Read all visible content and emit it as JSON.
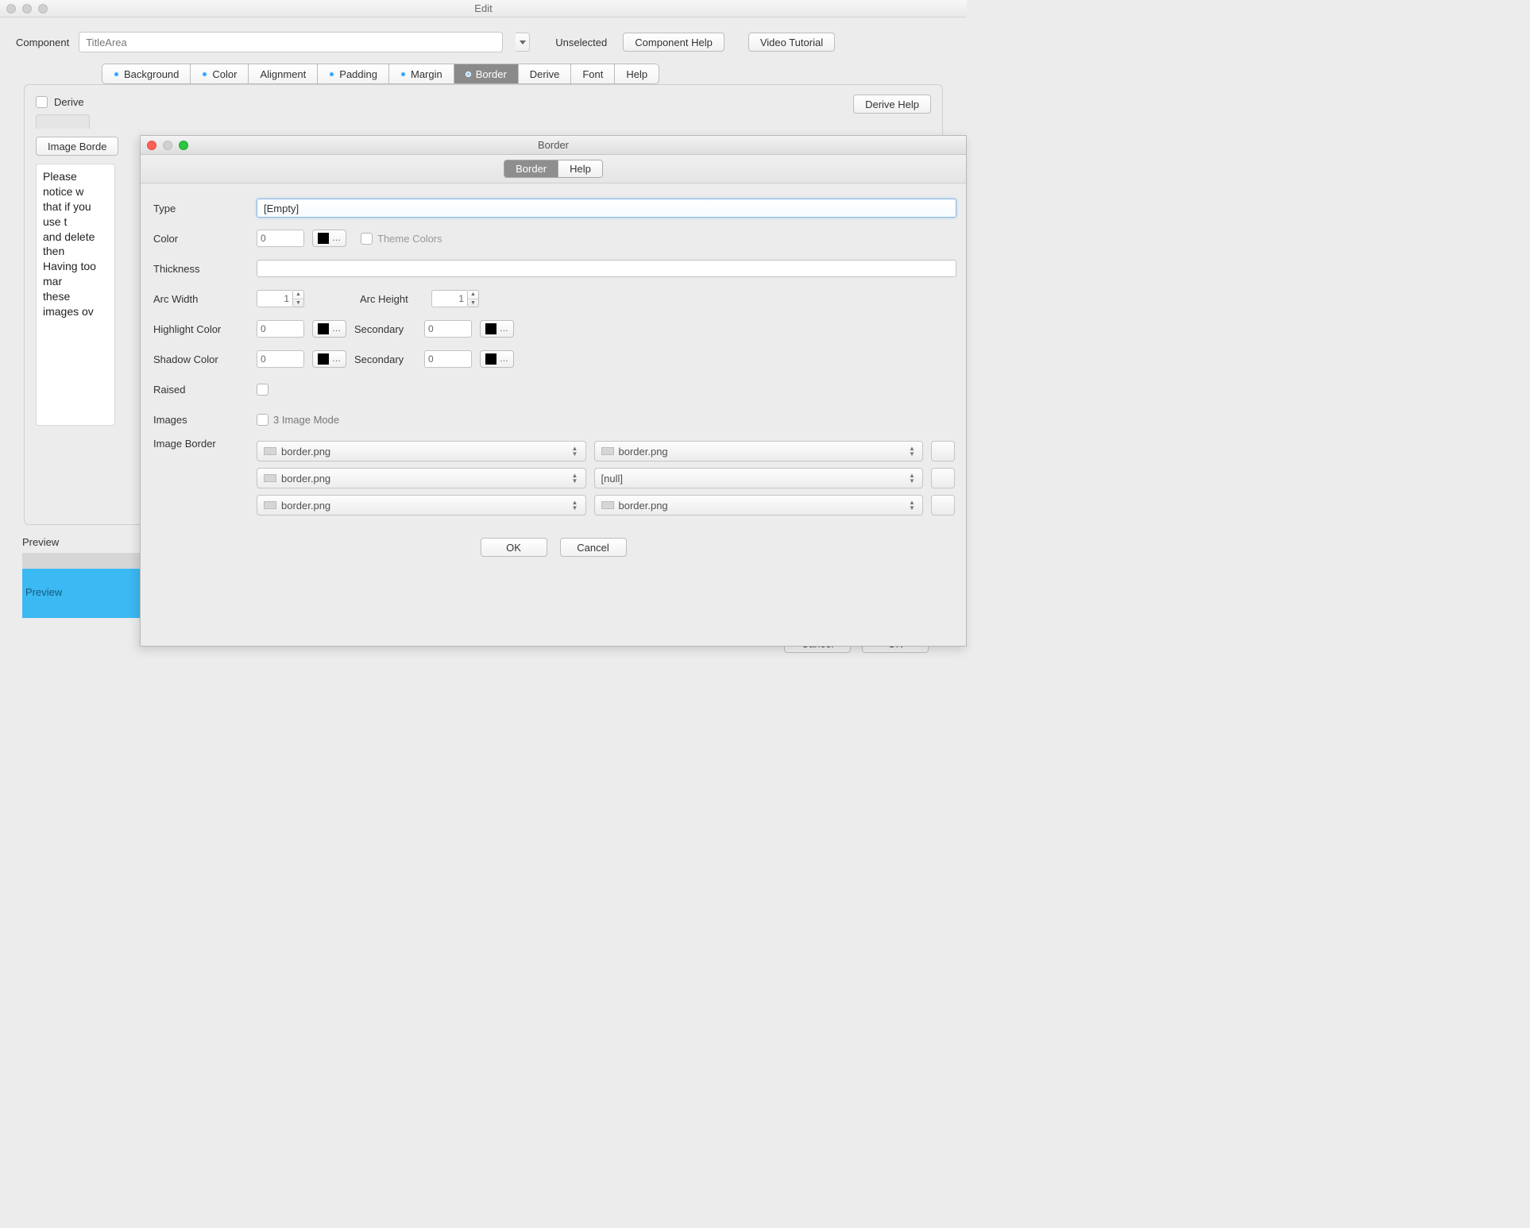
{
  "window_title": "Edit",
  "component": {
    "label": "Component",
    "value": "TitleArea",
    "state": "Unselected"
  },
  "header_buttons": {
    "component_help": "Component Help",
    "video_tutorial": "Video Tutorial"
  },
  "tabs": {
    "background": "Background",
    "color": "Color",
    "alignment": "Alignment",
    "padding": "Padding",
    "margin": "Margin",
    "border": "Border",
    "derive": "Derive",
    "font": "Font",
    "help": "Help"
  },
  "panel": {
    "derive": "Derive",
    "derive_help": "Derive Help",
    "image_border_btn": "Image Borde",
    "notice": "Please notice w\nthat if you use t\nand delete then\nHaving too mar\nthese images ov"
  },
  "preview": {
    "label": "Preview",
    "text": "Preview"
  },
  "bottom_buttons": {
    "cancel": "Cancel",
    "ok": "OK"
  },
  "modal": {
    "title": "Border",
    "tabs": {
      "border": "Border",
      "help": "Help"
    },
    "labels": {
      "type": "Type",
      "color": "Color",
      "thickness": "Thickness",
      "arc_width": "Arc Width",
      "arc_height": "Arc Height",
      "highlight_color": "Highlight Color",
      "secondary": "Secondary",
      "shadow_color": "Shadow Color",
      "raised": "Raised",
      "images": "Images",
      "image_border": "Image Border",
      "theme_colors": "Theme Colors",
      "three_image_mode": "3 Image Mode"
    },
    "values": {
      "type": "[Empty]",
      "color": "0",
      "thickness": "",
      "arc_width": "1",
      "arc_height": "1",
      "highlight_color": "0",
      "highlight_secondary": "0",
      "shadow_color": "0",
      "shadow_secondary": "0"
    },
    "image_border_options": [
      "border.png",
      "border.png",
      "border.png",
      "[null]",
      "border.png",
      "border.png"
    ],
    "buttons": {
      "ok": "OK",
      "cancel": "Cancel"
    }
  }
}
